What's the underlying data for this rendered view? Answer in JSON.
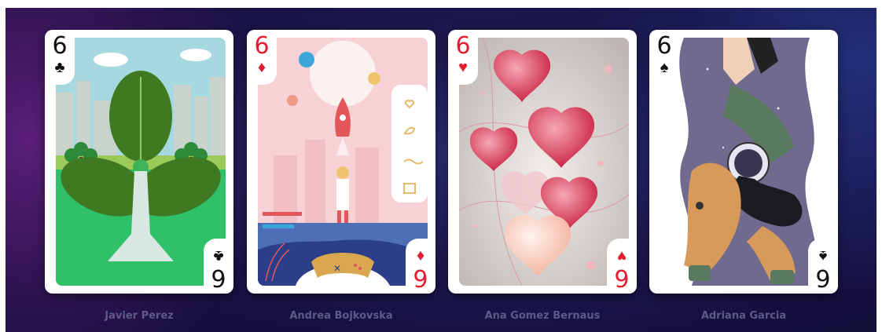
{
  "cards": [
    {
      "rank": "6",
      "suit": "♣",
      "suit_color": "#111111",
      "artist": "Javier Perez"
    },
    {
      "rank": "6",
      "suit": "♦",
      "suit_color": "#e11e2f",
      "artist": "Andrea Bojkovska"
    },
    {
      "rank": "6",
      "suit": "♥",
      "suit_color": "#e11e2f",
      "artist": "Ana Gomez Bernaus"
    },
    {
      "rank": "6",
      "suit": "♠",
      "suit_color": "#111111",
      "artist": "Adriana Garcia"
    }
  ]
}
